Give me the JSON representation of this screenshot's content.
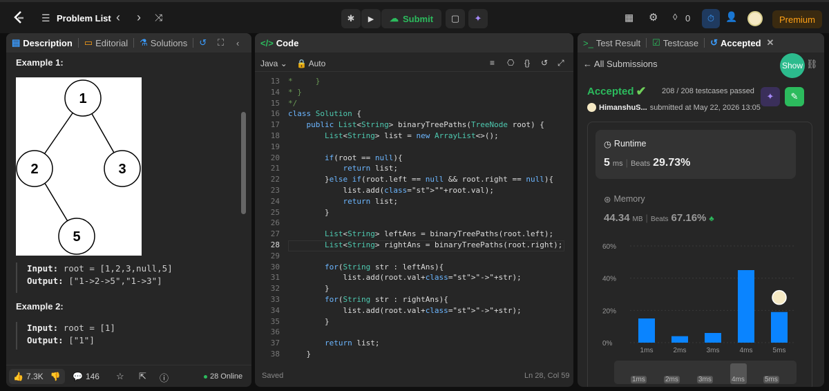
{
  "topbar": {
    "problem_list": "Problem List",
    "submit": "Submit",
    "streak": "0",
    "premium": "Premium"
  },
  "left": {
    "tabs": [
      "Description",
      "Editorial",
      "Solutions"
    ],
    "example1": "Example 1:",
    "tree_nodes": [
      "1",
      "2",
      "3",
      "5"
    ],
    "ex1_input_label": "Input:",
    "ex1_input": "root = [1,2,3,null,5]",
    "ex1_output_label": "Output:",
    "ex1_output": "[\"1->2->5\",\"1->3\"]",
    "example2": "Example 2:",
    "ex2_input_label": "Input:",
    "ex2_input": "root = [1]",
    "ex2_output_label": "Output:",
    "ex2_output": "[\"1\"]",
    "likes": "7.3K",
    "comments": "146",
    "online": "28 Online"
  },
  "code": {
    "tab": "Code",
    "lang": "Java",
    "mode": "Auto",
    "saved": "Saved",
    "cursor": "Ln 28, Col 59",
    "lines": [
      {
        "n": "13",
        "t": "*     }"
      },
      {
        "n": "14",
        "t": "* }"
      },
      {
        "n": "15",
        "t": "*/"
      },
      {
        "n": "16",
        "t": "class Solution {"
      },
      {
        "n": "17",
        "t": "    public List<String> binaryTreePaths(TreeNode root) {"
      },
      {
        "n": "18",
        "t": "        List<String> list = new ArrayList<>();"
      },
      {
        "n": "19",
        "t": ""
      },
      {
        "n": "20",
        "t": "        if(root == null){"
      },
      {
        "n": "21",
        "t": "            return list;"
      },
      {
        "n": "22",
        "t": "        }else if(root.left == null && root.right == null){"
      },
      {
        "n": "23",
        "t": "            list.add(\"\"+root.val);"
      },
      {
        "n": "24",
        "t": "            return list;"
      },
      {
        "n": "25",
        "t": "        }"
      },
      {
        "n": "26",
        "t": ""
      },
      {
        "n": "27",
        "t": "        List<String> leftAns = binaryTreePaths(root.left);"
      },
      {
        "n": "28",
        "t": "        List<String> rightAns = binaryTreePaths(root.right);"
      },
      {
        "n": "29",
        "t": ""
      },
      {
        "n": "30",
        "t": "        for(String str : leftAns){"
      },
      {
        "n": "31",
        "t": "            list.add(root.val+\"->\"+str);"
      },
      {
        "n": "32",
        "t": "        }"
      },
      {
        "n": "33",
        "t": "        for(String str : rightAns){"
      },
      {
        "n": "34",
        "t": "            list.add(root.val+\"->\"+str);"
      },
      {
        "n": "35",
        "t": "        }"
      },
      {
        "n": "36",
        "t": ""
      },
      {
        "n": "37",
        "t": "        return list;"
      },
      {
        "n": "38",
        "t": "    }"
      }
    ]
  },
  "right": {
    "tabs": [
      "Test Result",
      "Testcase",
      "Accepted"
    ],
    "all_submissions": "All Submissions",
    "show": "Show",
    "status": "Accepted",
    "testcases": "208 / 208 testcases passed",
    "user": "HimanshuS...",
    "submitted": "submitted at May 22, 2026 13:05",
    "runtime_label": "Runtime",
    "runtime_value": "5",
    "runtime_unit": "ms",
    "beats_label": "Beats",
    "runtime_beats": "29.73%",
    "memory_label": "Memory",
    "memory_value": "44.34",
    "memory_unit": "MB",
    "memory_beats": "67.16%"
  },
  "chart_data": {
    "type": "bar",
    "categories": [
      "1ms",
      "2ms",
      "3ms",
      "4ms",
      "5ms"
    ],
    "values": [
      15,
      4,
      6,
      45,
      19
    ],
    "yticks": [
      "60%",
      "40%",
      "20%",
      "0%"
    ],
    "ylim": [
      0,
      60
    ],
    "bar_color": "#0a84ff",
    "highlight": "5ms"
  }
}
